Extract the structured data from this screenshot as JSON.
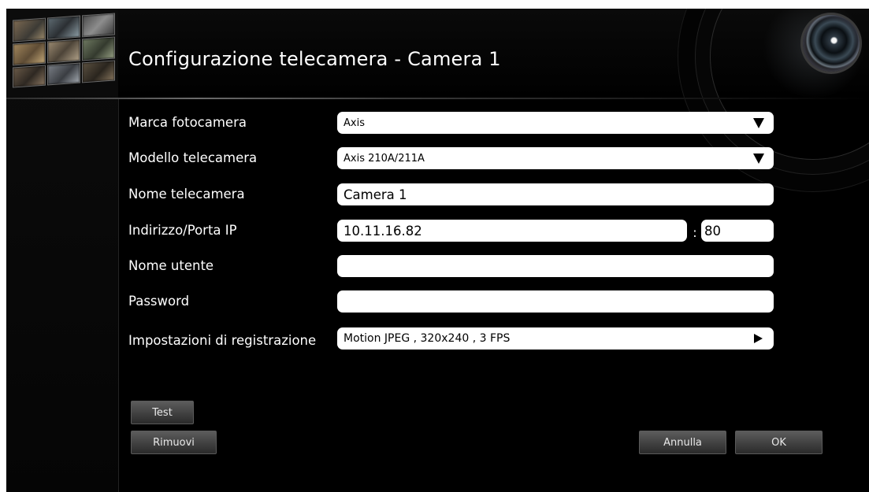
{
  "dialog": {
    "title": "Configurazione telecamera - Camera 1"
  },
  "form": {
    "brand": {
      "label": "Marca fotocamera",
      "value": "Axis"
    },
    "model": {
      "label": "Modello telecamera",
      "value": "Axis 210A/211A"
    },
    "name": {
      "label": "Nome telecamera",
      "value": "Camera 1"
    },
    "ip": {
      "label": "Indirizzo/Porta IP",
      "address": "10.11.16.82",
      "separator": ":",
      "port": "80"
    },
    "username": {
      "label": "Nome utente",
      "value": ""
    },
    "password": {
      "label": "Password",
      "value": ""
    },
    "recording": {
      "label": "Impostazioni di registrazione",
      "value": "Motion JPEG , 320x240 , 3 FPS"
    }
  },
  "buttons": {
    "test": "Test",
    "remove": "Rimuovi",
    "cancel": "Annulla",
    "ok": "OK"
  },
  "icons": {
    "dropdown": "chevron-down-icon",
    "submenu": "chevron-right-icon",
    "thumbnail": "camera-grid-thumbnail",
    "lens": "camera-lens-decoration"
  }
}
